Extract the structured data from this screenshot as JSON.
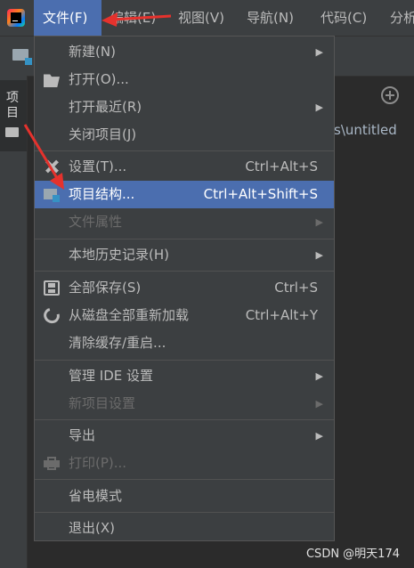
{
  "menubar": {
    "items": [
      "文件(F)",
      "编辑(E)",
      "视图(V)",
      "导航(N)",
      "代码(C)",
      "分析"
    ]
  },
  "sidebar": {
    "tab_label": "项目"
  },
  "editor": {
    "path_fragment": "s\\untitled"
  },
  "file_menu": {
    "items": [
      {
        "label": "新建(N)",
        "submenu": true
      },
      {
        "label": "打开(O)...",
        "icon": "folder-open-icon"
      },
      {
        "label": "打开最近(R)",
        "submenu": true
      },
      {
        "label": "关闭项目(J)"
      },
      {
        "label": "设置(T)...",
        "icon": "wrench-icon",
        "shortcut": "Ctrl+Alt+S"
      },
      {
        "label": "项目结构...",
        "icon": "project-structure-icon",
        "shortcut": "Ctrl+Alt+Shift+S",
        "highlighted": true
      },
      {
        "label": "文件属性",
        "submenu": true,
        "disabled": true
      },
      {
        "label": "本地历史记录(H)",
        "submenu": true
      },
      {
        "label": "全部保存(S)",
        "icon": "save-icon",
        "shortcut": "Ctrl+S"
      },
      {
        "label": "从磁盘全部重新加载",
        "icon": "reload-icon",
        "shortcut": "Ctrl+Alt+Y"
      },
      {
        "label": "清除缓存/重启..."
      },
      {
        "label": "管理 IDE 设置",
        "submenu": true
      },
      {
        "label": "新项目设置",
        "submenu": true,
        "disabled": true
      },
      {
        "label": "导出",
        "submenu": true
      },
      {
        "label": "打印(P)...",
        "icon": "print-icon",
        "disabled": true
      },
      {
        "label": "省电模式"
      },
      {
        "label": "退出(X)"
      }
    ]
  },
  "watermark": "CSDN @明天174",
  "colors": {
    "highlight": "#4b6eaf",
    "annotation": "#e5322d",
    "menu_bg": "#3c3f41"
  }
}
